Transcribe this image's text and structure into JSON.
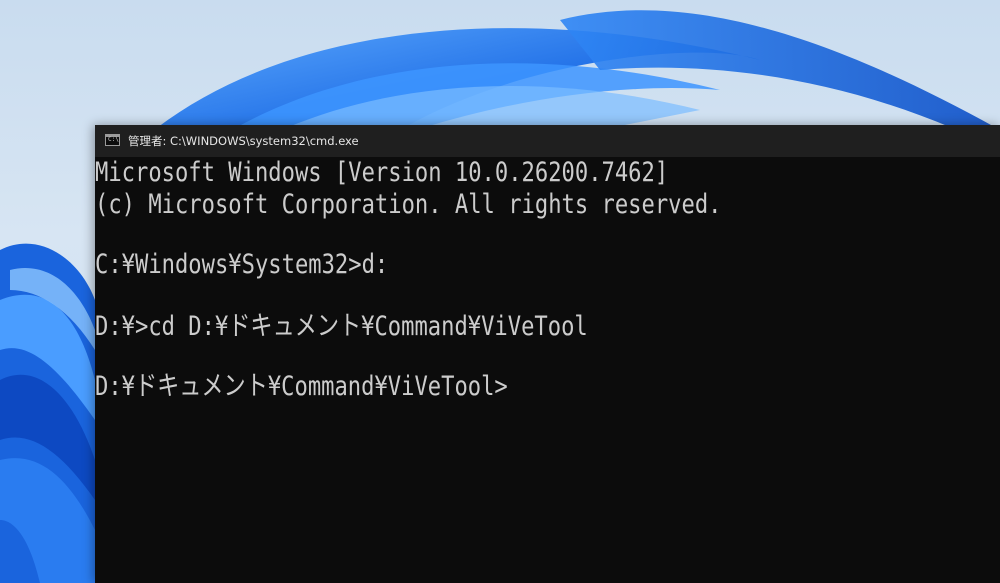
{
  "window": {
    "title": "管理者: C:\\WINDOWS\\system32\\cmd.exe",
    "icon": "cmd-console-icon",
    "icon_glyph": "C:\\"
  },
  "console": {
    "lines": [
      "Microsoft Windows [Version 10.0.26200.7462]",
      "(c) Microsoft Corporation. All rights reserved.",
      "C:¥Windows¥System32>d:",
      "D:¥>cd D:¥ドキュメント¥Command¥ViVeTool",
      "D:¥ドキュメント¥Command¥ViVeTool>"
    ]
  },
  "colors": {
    "console_background": "#0c0c0c",
    "console_text": "#cccccc",
    "titlebar": "#1f1f1f",
    "wallpaper_blue": "#1f6fe0"
  }
}
